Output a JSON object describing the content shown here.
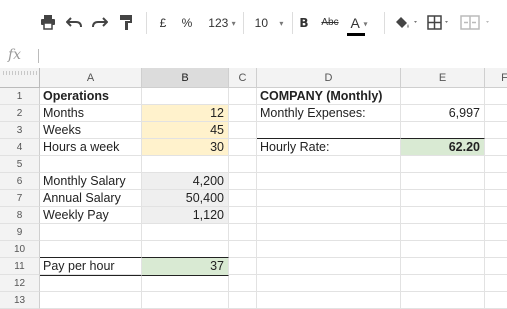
{
  "toolbar": {
    "currency": "£",
    "percent": "%",
    "number_format": "123",
    "font_size": "10",
    "bold": "B",
    "strikethrough": "Abc",
    "text_color": "A",
    "caret": "▾",
    "colors": {
      "text_color_bar": "#000000"
    }
  },
  "formula_bar": {
    "fx": "fx",
    "value": ""
  },
  "columns": [
    "A",
    "B",
    "C",
    "D",
    "E",
    "F"
  ],
  "selected_column": "B",
  "rows": [
    "1",
    "2",
    "3",
    "4",
    "5",
    "6",
    "7",
    "8",
    "9",
    "10",
    "11",
    "12",
    "13"
  ],
  "cells": {
    "A1": "Operations",
    "A2": "Months",
    "A3": "Weeks",
    "A4": "Hours a week",
    "A6": "Monthly Salary",
    "A7": "Annual Salary",
    "A8": "Weekly Pay",
    "A11": "Pay per hour",
    "B2": "12",
    "B3": "45",
    "B4": "30",
    "B6": "4,200",
    "B7": "50,400",
    "B8": "1,120",
    "B11": "37",
    "D1": "COMPANY (Monthly)",
    "D2": "Monthly Expenses:",
    "D4": "Hourly Rate:",
    "E2": "6,997",
    "E4": "62.20"
  },
  "colors": {
    "input_fill": "#fff2cc",
    "calc_fill": "#efefef",
    "result_fill": "#d9ead3"
  }
}
